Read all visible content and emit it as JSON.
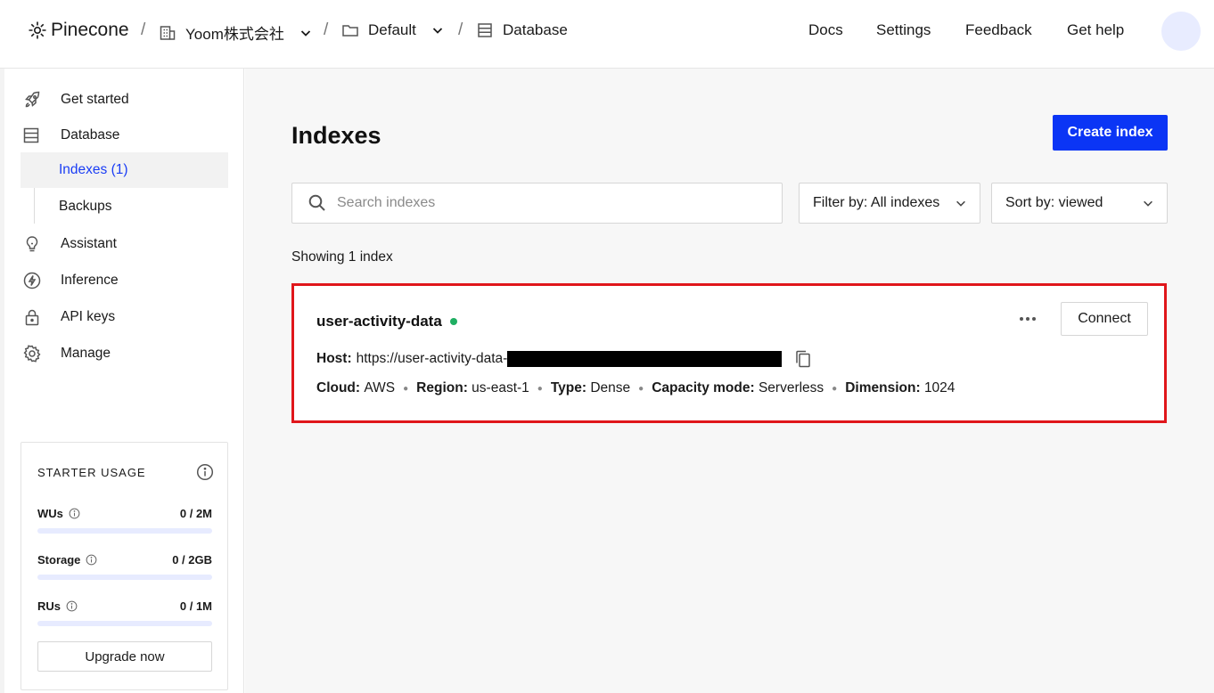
{
  "header": {
    "brand": "Pinecone",
    "org": "Yoom株式会社",
    "project": "Default",
    "section": "Database",
    "nav": [
      "Docs",
      "Settings",
      "Feedback",
      "Get help"
    ]
  },
  "sidebar": {
    "items": [
      {
        "label": "Get started",
        "icon": "rocket-icon"
      },
      {
        "label": "Database",
        "icon": "database-icon"
      },
      {
        "label": "Assistant",
        "icon": "lightbulb-icon"
      },
      {
        "label": "Inference",
        "icon": "bolt-icon"
      },
      {
        "label": "API keys",
        "icon": "lock-icon"
      },
      {
        "label": "Manage",
        "icon": "gear-icon"
      }
    ],
    "subitems": [
      {
        "label": "Indexes (1)",
        "active": true
      },
      {
        "label": "Backups",
        "active": false
      }
    ],
    "usage": {
      "title": "STARTER USAGE",
      "rows": [
        {
          "label": "WUs",
          "value": "0 / 2M",
          "fraction": 0
        },
        {
          "label": "Storage",
          "value": "0 / 2GB",
          "fraction": 0
        },
        {
          "label": "RUs",
          "value": "0 / 1M",
          "fraction": 0
        }
      ],
      "upgrade_label": "Upgrade now"
    }
  },
  "main": {
    "title": "Indexes",
    "create_label": "Create index",
    "search_placeholder": "Search indexes",
    "filter_label": "Filter by: All indexes",
    "sort_label": "Sort by: viewed",
    "showing": "Showing 1 index",
    "index": {
      "name": "user-activity-data",
      "status_color": "#1fae62",
      "connect_label": "Connect",
      "host_label": "Host:",
      "host_value": "https://user-activity-data-",
      "cloud_label": "Cloud:",
      "cloud_value": "AWS",
      "region_label": "Region:",
      "region_value": "us-east-1",
      "type_label": "Type:",
      "type_value": "Dense",
      "capacity_label": "Capacity mode:",
      "capacity_value": "Serverless",
      "dimension_label": "Dimension:",
      "dimension_value": "1024"
    }
  },
  "colors": {
    "accent": "#0b35f5",
    "active_nav_text": "#1a3df5",
    "highlight_border": "#e0161b"
  }
}
